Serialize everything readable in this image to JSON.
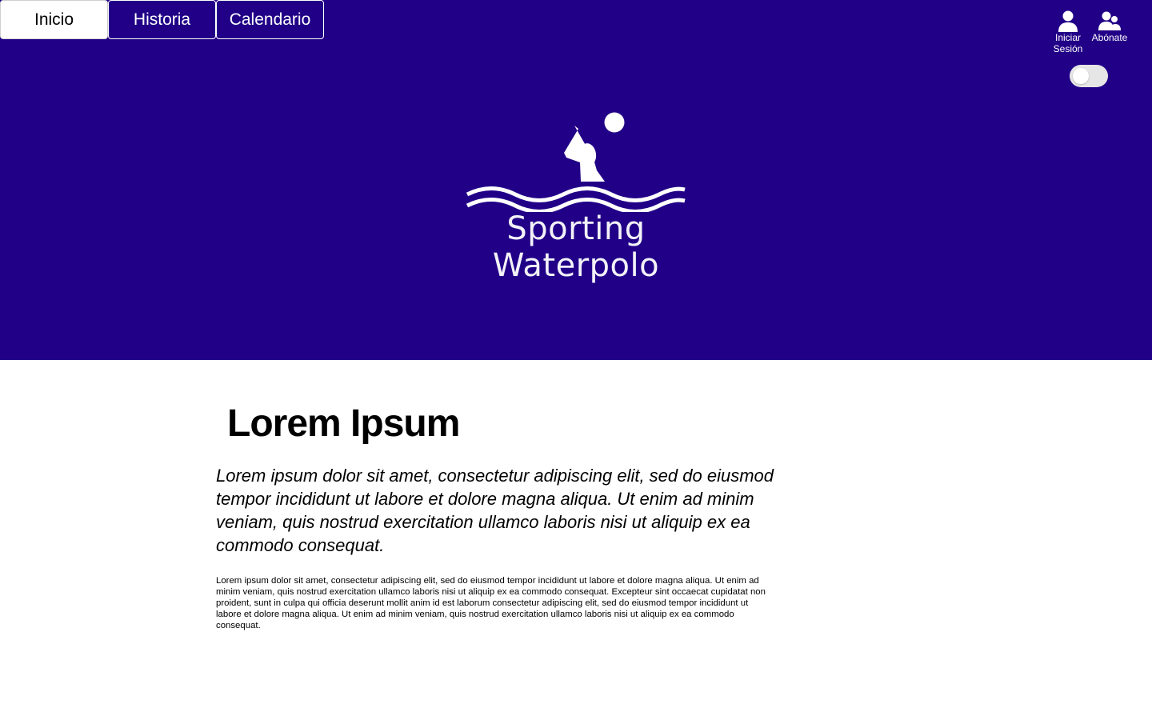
{
  "colors": {
    "brand": "#210087",
    "toggle_track": "#e6e6e6",
    "text": "#000000",
    "on_brand": "#ffffff"
  },
  "nav": {
    "tabs": [
      {
        "label": "Inicio",
        "active": true
      },
      {
        "label": "Historia",
        "active": false
      },
      {
        "label": "Calendario",
        "active": false
      }
    ]
  },
  "user_actions": {
    "login": {
      "label": "Iniciar Sesión",
      "icon": "user-icon"
    },
    "subscribe": {
      "label": "Abónate",
      "icon": "users-icon"
    }
  },
  "theme_toggle": {
    "on": false
  },
  "logo": {
    "text": "Sporting Waterpolo",
    "icon": "waterpolo-swimmer-icon"
  },
  "article": {
    "title": "Lorem Ipsum",
    "lead": "Lorem ipsum dolor sit amet, consectetur adipiscing elit, sed do eiusmod tempor incididunt ut labore et dolore magna aliqua. Ut enim ad minim veniam, quis nostrud exercitation ullamco laboris nisi ut aliquip ex ea commodo consequat.",
    "body": "Lorem ipsum dolor sit amet, consectetur adipiscing elit, sed do eiusmod tempor incididunt ut labore et dolore magna aliqua. Ut enim ad minim veniam, quis nostrud exercitation ullamco laboris nisi ut aliquip ex ea commodo consequat. Excepteur sint occaecat cupidatat non proident, sunt in culpa qui officia deserunt mollit anim id est laborum consectetur adipiscing elit, sed do eiusmod tempor incididunt ut labore et dolore magna aliqua. Ut enim ad minim veniam, quis nostrud exercitation ullamco laboris nisi ut aliquip ex ea commodo consequat."
  }
}
